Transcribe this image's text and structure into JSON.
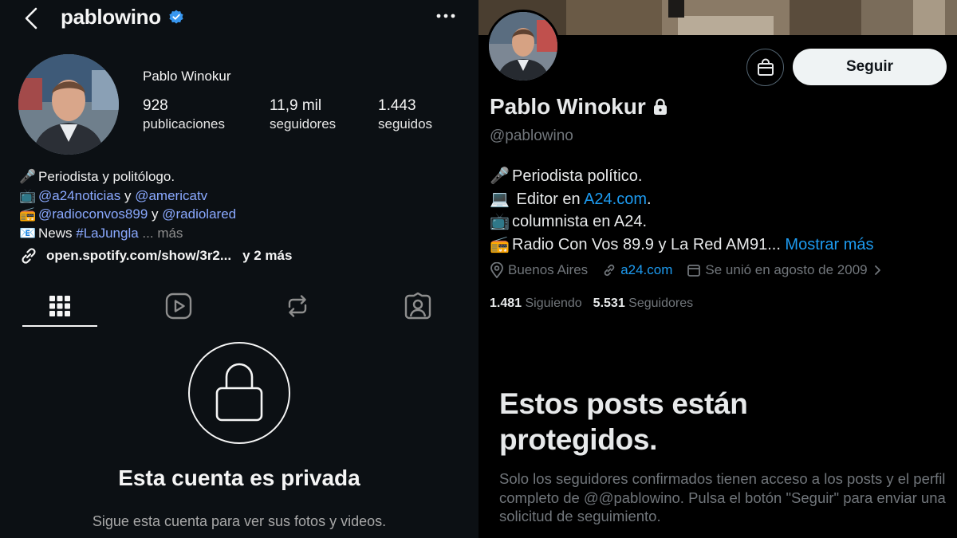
{
  "instagram": {
    "username": "pablowino",
    "full_name": "Pablo Winokur",
    "stats": [
      {
        "value": "928",
        "label": "publicaciones"
      },
      {
        "value": "11,9 mil",
        "label": "seguidores"
      },
      {
        "value": "1.443",
        "label": "seguidos"
      }
    ],
    "bio": {
      "line1_emoji": "🎤",
      "line1_text": "Periodista y politólogo.",
      "line2_emoji": "📺",
      "line2_link1": "@a24noticias",
      "line2_mid": " y ",
      "line2_link2": "@americatv",
      "line3_emoji": "📻",
      "line3_link1": "@radioconvos899",
      "line3_mid": " y ",
      "line3_link2": "@radiolared",
      "line4_emoji": "📧",
      "line4_text": "News ",
      "line4_link": "#LaJungla",
      "line4_more": " ... más"
    },
    "link_text": "open.spotify.com/show/3r2...",
    "link_more": "y 2 más",
    "tabs": [
      "grid-icon",
      "reels-icon",
      "reposts-icon",
      "tagged-icon"
    ],
    "private_title": "Esta cuenta es privada",
    "private_subtitle": "Sigue esta cuenta para ver sus fotos y videos."
  },
  "x": {
    "name": "Pablo Winokur",
    "handle": "@pablowino",
    "follow_label": "Seguir",
    "bio": {
      "line1_emoji": "🎤",
      "line1_text": "Periodista político.",
      "line2_emoji": "💻",
      "line2_text": " Editor en ",
      "line2_link": "A24.com",
      "line2_end": ".",
      "line3_emoji": "📺",
      "line3_text": "columnista en A24.",
      "line4_emoji": "📻",
      "line4_text": "Radio Con Vos 89.9 y La Red AM91...",
      "line4_more": " Mostrar más"
    },
    "location": "Buenos Aires",
    "website": "a24.com",
    "joined": "Se unió en agosto de 2009",
    "following_count": "1.481",
    "following_label": " Siguiendo",
    "followers_count": "5.531",
    "followers_label": " Seguidores",
    "protected_title_line1": "Estos posts están",
    "protected_title_line2": "protegidos.",
    "protected_text": "Solo los seguidores confirmados tienen acceso a los posts y el perfil completo de @@pablowino. Pulsa el botón \"Seguir\" para enviar una solicitud de seguimiento."
  },
  "colors": {
    "ig_bg": "#0c1014",
    "ig_link": "#8aa9ff",
    "ig_verified": "#3897f0",
    "x_bg": "#000000",
    "x_link": "#1d9bf0",
    "x_muted": "#71767b"
  }
}
